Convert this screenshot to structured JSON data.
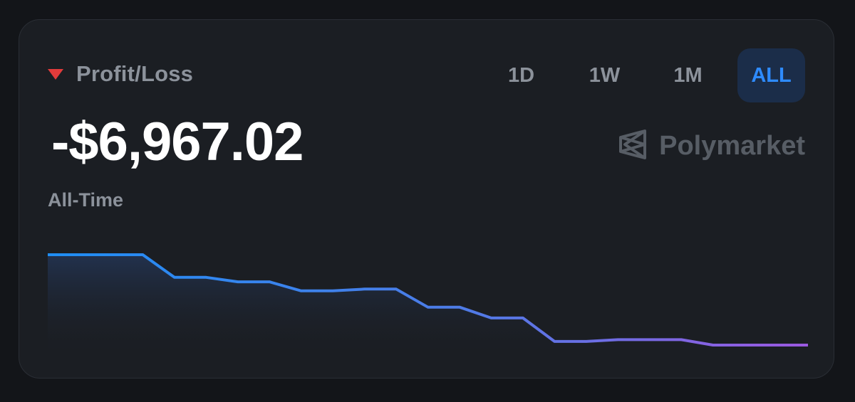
{
  "widget": {
    "label": "Profit/Loss",
    "amount": "-$6,967.02",
    "period": "All-Time",
    "trend": "down",
    "trend_color": "#e23b3b"
  },
  "tabs": [
    {
      "label": "1D",
      "active": false
    },
    {
      "label": "1W",
      "active": false
    },
    {
      "label": "1M",
      "active": false
    },
    {
      "label": "ALL",
      "active": true
    }
  ],
  "brand": {
    "name": "Polymarket",
    "icon": "polymarket-logo-icon"
  },
  "colors": {
    "background": "#131519",
    "card": "#1b1e23",
    "line_start": "#1f8ef5",
    "line_end": "#9b59e0",
    "active_tab_bg": "#1b2d49",
    "active_tab_text": "#2e8bff"
  },
  "chart_data": {
    "type": "line",
    "values": [
      0,
      0,
      0,
      0,
      -250,
      -250,
      -300,
      -300,
      -400,
      -400,
      -380,
      -380,
      -580,
      -580,
      -700,
      -700,
      -960,
      -960,
      -940,
      -940,
      -940,
      -1000,
      -1000,
      -1000,
      -1000
    ],
    "grid": false
  }
}
